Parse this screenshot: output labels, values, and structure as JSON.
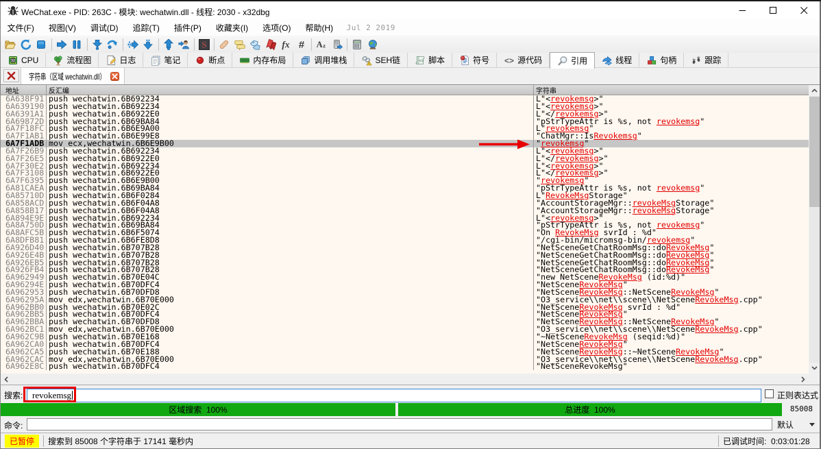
{
  "window": {
    "title": "WeChat.exe - PID: 263C - 模块: wechatwin.dll - 线程: 2030 - x32dbg",
    "controls": [
      "minimize",
      "maximize",
      "close"
    ],
    "app_icon": "bug-icon"
  },
  "menu": {
    "items": [
      "文件(F)",
      "视图(V)",
      "调试(D)",
      "追踪(T)",
      "插件(P)",
      "收藏夹(I)",
      "选项(O)",
      "帮助(H)"
    ],
    "build_date": "Jul 2 2019"
  },
  "toolbar": {
    "icons": [
      "open-folder",
      "restart",
      "stop",
      "run",
      "pause",
      "step-into",
      "step-over",
      "animate-into",
      "skip-next",
      "execute-till-return",
      "run-to-user-code",
      "scylla",
      "patches",
      "comments",
      "labels",
      "bookmarks",
      "functions",
      "control-flow",
      "strings",
      "calls",
      "calculator",
      "internet"
    ]
  },
  "view_tabs": {
    "tabs": [
      {
        "label": "CPU",
        "icon": "cpu-chip-icon",
        "active": false
      },
      {
        "label": "流程图",
        "icon": "graph-tree-icon",
        "active": false
      },
      {
        "label": "日志",
        "icon": "log-page-pencil-icon",
        "active": false
      },
      {
        "label": "笔记",
        "icon": "notes-icon",
        "active": false
      },
      {
        "label": "断点",
        "icon": "breakpoint-dot-icon",
        "active": false
      },
      {
        "label": "内存布局",
        "icon": "memory-map-icon",
        "active": false
      },
      {
        "label": "调用堆栈",
        "icon": "call-stack-icon",
        "active": false
      },
      {
        "label": "SEH链",
        "icon": "seh-chain-icon",
        "active": false
      },
      {
        "label": "脚本",
        "icon": "script-icon",
        "active": false
      },
      {
        "label": "符号",
        "icon": "symbols-icon",
        "active": false
      },
      {
        "label": "源代码",
        "icon": "source-code-icon",
        "active": false
      },
      {
        "label": "引用",
        "icon": "references-magnifier-icon",
        "active": true
      },
      {
        "label": "线程",
        "icon": "threads-icon",
        "active": false
      },
      {
        "label": "句柄",
        "icon": "handles-cubes-icon",
        "active": false
      },
      {
        "label": "跟踪",
        "icon": "trace-footprints-icon",
        "active": false
      }
    ]
  },
  "doc_tab": {
    "label": "字符串（区域 wechatwin.dll）",
    "close_icon": "close-icon"
  },
  "table": {
    "headers": [
      "地址",
      "反汇编",
      "字符串"
    ],
    "rows": [
      {
        "address": "6A638F91",
        "disassembly": "push wechatwin.6B692234",
        "string_segments": [
          [
            "L\"<",
            0
          ],
          [
            "revokemsg",
            1
          ],
          [
            ">\"",
            0
          ]
        ],
        "selected": false
      },
      {
        "address": "6A639190",
        "disassembly": "push wechatwin.6B692234",
        "string_segments": [
          [
            "L\"<",
            0
          ],
          [
            "revokemsg",
            1
          ],
          [
            ">\"",
            0
          ]
        ],
        "selected": false
      },
      {
        "address": "6A6391A1",
        "disassembly": "push wechatwin.6B6922E0",
        "string_segments": [
          [
            "L\"</",
            0
          ],
          [
            "revokemsg",
            1
          ],
          [
            ">\"",
            0
          ]
        ],
        "selected": false
      },
      {
        "address": "6A69872D",
        "disassembly": "push wechatwin.6B69BA84",
        "string_segments": [
          [
            "\"pStrTypeAttr is %s, not ",
            0
          ],
          [
            "revokemsg",
            1
          ],
          [
            "\"",
            0
          ]
        ],
        "selected": false
      },
      {
        "address": "6A7F18FC",
        "disassembly": "push wechatwin.6B6E9A00",
        "string_segments": [
          [
            "L\"",
            0
          ],
          [
            "revokemsg",
            1
          ],
          [
            "\"",
            0
          ]
        ],
        "selected": false
      },
      {
        "address": "6A7F1AB1",
        "disassembly": "push wechatwin.6B6E99E8",
        "string_segments": [
          [
            "\"ChatMgr::Is",
            0
          ],
          [
            "Revokemsg",
            1
          ],
          [
            "\"",
            0
          ]
        ],
        "selected": false
      },
      {
        "address": "6A7F1ADB",
        "disassembly": "mov ecx,wechatwin.6B6E9B00",
        "string_segments": [
          [
            "\"",
            0
          ],
          [
            "revokemsg",
            1
          ],
          [
            "\"",
            0
          ]
        ],
        "selected": true
      },
      {
        "address": "6A7F26B9",
        "disassembly": "push wechatwin.6B692234",
        "string_segments": [
          [
            "L\"<",
            0
          ],
          [
            "revokemsg",
            1
          ],
          [
            ">\"",
            0
          ]
        ],
        "selected": false
      },
      {
        "address": "6A7F26E5",
        "disassembly": "push wechatwin.6B6922E0",
        "string_segments": [
          [
            "L\"</",
            0
          ],
          [
            "revokemsg",
            1
          ],
          [
            ">\"",
            0
          ]
        ],
        "selected": false
      },
      {
        "address": "6A7F30E2",
        "disassembly": "push wechatwin.6B692234",
        "string_segments": [
          [
            "L\"<",
            0
          ],
          [
            "revokemsg",
            1
          ],
          [
            ">\"",
            0
          ]
        ],
        "selected": false
      },
      {
        "address": "6A7F3108",
        "disassembly": "push wechatwin.6B6922E0",
        "string_segments": [
          [
            "L\"</",
            0
          ],
          [
            "revokemsg",
            1
          ],
          [
            ">\"",
            0
          ]
        ],
        "selected": false
      },
      {
        "address": "6A7F6395",
        "disassembly": "push wechatwin.6B6E9B00",
        "string_segments": [
          [
            "\"",
            0
          ],
          [
            "revokemsg",
            1
          ],
          [
            "\"",
            0
          ]
        ],
        "selected": false
      },
      {
        "address": "6A81CAEA",
        "disassembly": "push wechatwin.6B69BA84",
        "string_segments": [
          [
            "\"pStrTypeAttr is %s, not ",
            0
          ],
          [
            "revokemsg",
            1
          ],
          [
            "\"",
            0
          ]
        ],
        "selected": false
      },
      {
        "address": "6A85710D",
        "disassembly": "push wechatwin.6B6F0284",
        "string_segments": [
          [
            "L\"",
            0
          ],
          [
            "RevokeMsg",
            1
          ],
          [
            "Storage\"",
            0
          ]
        ],
        "selected": false
      },
      {
        "address": "6A858ACD",
        "disassembly": "push wechatwin.6B6F04A8",
        "string_segments": [
          [
            "\"AccountStorageMgr::",
            0
          ],
          [
            "revokeMsg",
            1
          ],
          [
            "Storage\"",
            0
          ]
        ],
        "selected": false
      },
      {
        "address": "6A858B17",
        "disassembly": "push wechatwin.6B6F04A8",
        "string_segments": [
          [
            "\"AccountStorageMgr::",
            0
          ],
          [
            "revokeMsg",
            1
          ],
          [
            "Storage\"",
            0
          ]
        ],
        "selected": false
      },
      {
        "address": "6A894E9E",
        "disassembly": "push wechatwin.6B692234",
        "string_segments": [
          [
            "L\"<",
            0
          ],
          [
            "revokemsg",
            1
          ],
          [
            ">\"",
            0
          ]
        ],
        "selected": false
      },
      {
        "address": "6A8A750D",
        "disassembly": "push wechatwin.6B69BA84",
        "string_segments": [
          [
            "\"pStrTypeAttr is %s, not ",
            0
          ],
          [
            "revokemsg",
            1
          ],
          [
            "\"",
            0
          ]
        ],
        "selected": false
      },
      {
        "address": "6A8AFC5B",
        "disassembly": "push wechatwin.6B6F5074",
        "string_segments": [
          [
            "\"On ",
            0
          ],
          [
            "RevokeMsg",
            1
          ],
          [
            " svrId : %d\"",
            0
          ]
        ],
        "selected": false
      },
      {
        "address": "6A8DFB81",
        "disassembly": "push wechatwin.6B6FE8D8",
        "string_segments": [
          [
            "\"/cgi-bin/micromsg-bin/",
            0
          ],
          [
            "revokemsg",
            1
          ],
          [
            "\"",
            0
          ]
        ],
        "selected": false
      },
      {
        "address": "6A926D40",
        "disassembly": "push wechatwin.6B707B28",
        "string_segments": [
          [
            "\"NetSceneGetChatRoomMsg::do",
            0
          ],
          [
            "RevokeMsg",
            1
          ],
          [
            "\"",
            0
          ]
        ],
        "selected": false
      },
      {
        "address": "6A926E4B",
        "disassembly": "push wechatwin.6B707B28",
        "string_segments": [
          [
            "\"NetSceneGetChatRoomMsg::do",
            0
          ],
          [
            "RevokeMsg",
            1
          ],
          [
            "\"",
            0
          ]
        ],
        "selected": false
      },
      {
        "address": "6A926EB5",
        "disassembly": "push wechatwin.6B707B28",
        "string_segments": [
          [
            "\"NetSceneGetChatRoomMsg::do",
            0
          ],
          [
            "RevokeMsg",
            1
          ],
          [
            "\"",
            0
          ]
        ],
        "selected": false
      },
      {
        "address": "6A926FB4",
        "disassembly": "push wechatwin.6B707B28",
        "string_segments": [
          [
            "\"NetSceneGetChatRoomMsg::do",
            0
          ],
          [
            "RevokeMsg",
            1
          ],
          [
            "\"",
            0
          ]
        ],
        "selected": false
      },
      {
        "address": "6A962949",
        "disassembly": "push wechatwin.6B70E04C",
        "string_segments": [
          [
            "\"new NetScene",
            0
          ],
          [
            "RevokeMsg",
            1
          ],
          [
            " (id:%d)\"",
            0
          ]
        ],
        "selected": false
      },
      {
        "address": "6A96294E",
        "disassembly": "push wechatwin.6B70DFC4",
        "string_segments": [
          [
            "\"NetScene",
            0
          ],
          [
            "RevokeMsg",
            1
          ],
          [
            "\"",
            0
          ]
        ],
        "selected": false
      },
      {
        "address": "6A962953",
        "disassembly": "push wechatwin.6B70DFD8",
        "string_segments": [
          [
            "\"NetScene",
            0
          ],
          [
            "RevokeMsg",
            1
          ],
          [
            "::NetScene",
            0
          ],
          [
            "RevokeMsg",
            1
          ],
          [
            "\"",
            0
          ]
        ],
        "selected": false
      },
      {
        "address": "6A96295A",
        "disassembly": "mov edx,wechatwin.6B70E000",
        "string_segments": [
          [
            "\"O3_service\\\\net\\\\scene\\\\NetScene",
            0
          ],
          [
            "RevokeMsg",
            1
          ],
          [
            ".cpp\"",
            0
          ]
        ],
        "selected": false
      },
      {
        "address": "6A962BB0",
        "disassembly": "push wechatwin.6B70E02C",
        "string_segments": [
          [
            "\"NetScene",
            0
          ],
          [
            "RevokeMsg",
            1
          ],
          [
            " svrId : %d\"",
            0
          ]
        ],
        "selected": false
      },
      {
        "address": "6A962BB5",
        "disassembly": "push wechatwin.6B70DFC4",
        "string_segments": [
          [
            "\"NetScene",
            0
          ],
          [
            "RevokeMsg",
            1
          ],
          [
            "\"",
            0
          ]
        ],
        "selected": false
      },
      {
        "address": "6A962BBA",
        "disassembly": "push wechatwin.6B70DFD8",
        "string_segments": [
          [
            "\"NetScene",
            0
          ],
          [
            "RevokeMsg",
            1
          ],
          [
            "::NetScene",
            0
          ],
          [
            "RevokeMsg",
            1
          ],
          [
            "\"",
            0
          ]
        ],
        "selected": false
      },
      {
        "address": "6A962BC1",
        "disassembly": "mov edx,wechatwin.6B70E000",
        "string_segments": [
          [
            "\"O3_service\\\\net\\\\scene\\\\NetScene",
            0
          ],
          [
            "RevokeMsg",
            1
          ],
          [
            ".cpp\"",
            0
          ]
        ],
        "selected": false
      },
      {
        "address": "6A962C9B",
        "disassembly": "push wechatwin.6B70E168",
        "string_segments": [
          [
            "\"~NetScene",
            0
          ],
          [
            "RevokeMsg",
            1
          ],
          [
            " (seqid:%d)\"",
            0
          ]
        ],
        "selected": false
      },
      {
        "address": "6A962CA0",
        "disassembly": "push wechatwin.6B70DFC4",
        "string_segments": [
          [
            "\"NetScene",
            0
          ],
          [
            "RevokeMsg",
            1
          ],
          [
            "\"",
            0
          ]
        ],
        "selected": false
      },
      {
        "address": "6A962CA5",
        "disassembly": "push wechatwin.6B70E188",
        "string_segments": [
          [
            "\"NetScene",
            0
          ],
          [
            "RevokeMsg",
            1
          ],
          [
            "::~NetScene",
            0
          ],
          [
            "RevokeMsg",
            1
          ],
          [
            "\"",
            0
          ]
        ],
        "selected": false
      },
      {
        "address": "6A962CAC",
        "disassembly": "mov edx,wechatwin.6B70E000",
        "string_segments": [
          [
            "\"O3_service\\\\net\\\\scene\\\\NetScene",
            0
          ],
          [
            "RevokeMsg",
            1
          ],
          [
            ".cpp\"",
            0
          ]
        ],
        "selected": false
      },
      {
        "address": "6A962E8C",
        "disassembly": "push wechatwin.6B70DFC4",
        "string_segments": [
          [
            "\"NetSceneRevokeMsg\"",
            0
          ]
        ],
        "selected": false
      }
    ]
  },
  "search": {
    "label": "搜索:",
    "value": "revokemsg",
    "regex_label": "正则表达式",
    "regex_checked": false
  },
  "progress": {
    "region_label": "区域搜索  100%",
    "total_label": "总进度  100%",
    "count": "85008"
  },
  "command": {
    "label": "命令:",
    "value": "",
    "combo_value": "默认"
  },
  "status": {
    "state": "已暂停",
    "message": "搜索到 85008 个字符串于 17141 毫秒内",
    "time_label": "已调试时间:",
    "time_value": "0:03:01:28"
  },
  "annotations": {
    "arrow": "red arrow pointing to selected string row",
    "rectangle": "red rectangle around search text"
  },
  "colors": {
    "table_background": "#fff8f0",
    "selection": "#c6c6c6",
    "highlight": "#e30000",
    "progress_green": "#11a811",
    "status_paused_bg": "#ffff00",
    "status_paused_fg": "#f00000",
    "focus_border": "#3a86d3"
  }
}
